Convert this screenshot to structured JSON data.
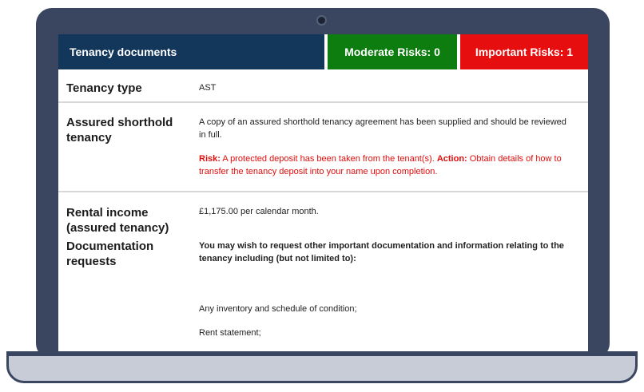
{
  "header": {
    "title": "Tenancy documents",
    "moderate": "Moderate Risks: 0",
    "important": "Important Risks: 1"
  },
  "rows": {
    "tenancy_type": {
      "label": "Tenancy type",
      "value": "AST"
    },
    "ast": {
      "label": "Assured shorthold tenancy",
      "value": "A copy of an assured shorthold tenancy agreement has been supplied and should be reviewed in full.",
      "risk_label": "Risk:",
      "risk_text": "A protected deposit has been taken from the tenant(s).",
      "action_label": "Action:",
      "action_text": "Obtain details of how to transfer the tenancy deposit into your name upon completion."
    },
    "rental": {
      "label": "Rental income (assured tenancy)",
      "value": "£1,175.00 per calendar month."
    },
    "docs": {
      "label": "Documentation requests",
      "intro": "You may wish to request other important documentation and information relating to the tenancy including (but not limited to):",
      "items": [
        "Any inventory and schedule of condition;",
        "Rent statement;"
      ]
    }
  },
  "colors": {
    "title_bg": "#13375a",
    "moderate_bg": "#0d7d10",
    "important_bg": "#e60e0e",
    "risk_text": "#e30c0c"
  }
}
